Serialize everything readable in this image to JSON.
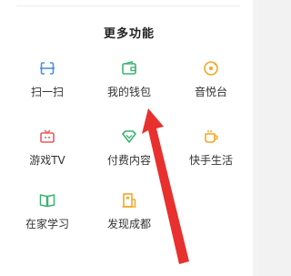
{
  "section": {
    "title": "更多功能"
  },
  "items": [
    {
      "label": "扫一扫",
      "icon": "scan-icon",
      "color": "#4a90e2"
    },
    {
      "label": "我的钱包",
      "icon": "wallet-icon",
      "color": "#3cb371"
    },
    {
      "label": "音悦台",
      "icon": "music-disc-icon",
      "color": "#f5a623"
    },
    {
      "label": "游戏TV",
      "icon": "game-tv-icon",
      "color": "#e85a5a"
    },
    {
      "label": "付费内容",
      "icon": "diamond-icon",
      "color": "#3cb371"
    },
    {
      "label": "快手生活",
      "icon": "cup-icon",
      "color": "#f5a623"
    },
    {
      "label": "在家学习",
      "icon": "book-icon",
      "color": "#3cb371"
    },
    {
      "label": "发现成都",
      "icon": "building-icon",
      "color": "#f5a623"
    }
  ],
  "annotation": {
    "icon": "red-arrow-pointer",
    "color": "#e8302e"
  }
}
